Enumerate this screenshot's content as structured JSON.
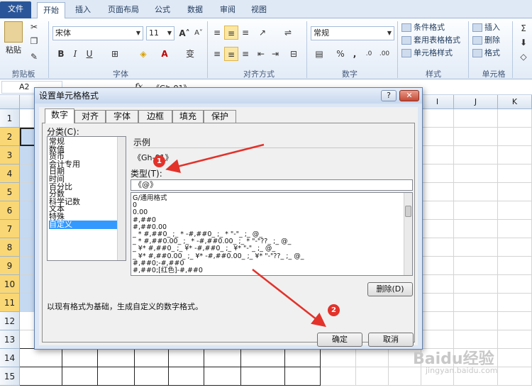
{
  "ribbon": {
    "tabs": [
      "文件",
      "开始",
      "插入",
      "页面布局",
      "公式",
      "数据",
      "审阅",
      "视图"
    ],
    "paste_label": "粘贴",
    "font_name": "宋体",
    "font_size": "11",
    "number_format": "常规",
    "styles": {
      "conditional": "条件格式",
      "table": "套用表格格式",
      "cell": "单元格样式"
    },
    "cells": {
      "insert": "插入",
      "delete": "删除",
      "format": "格式"
    },
    "groups": [
      "剪贴板",
      "字体",
      "对齐方式",
      "数字",
      "样式",
      "单元格"
    ],
    "icons": [
      "cut-icon",
      "copy-icon",
      "format-painter-icon",
      "bold-icon",
      "italic-icon",
      "underline-icon",
      "border-icon",
      "fill-color-icon",
      "font-color-icon",
      "align-icons",
      "percent-icon",
      "sum-icon"
    ]
  },
  "formula_bar": {
    "name_box": "A2",
    "fx": "fx",
    "content": "《Gh-01》"
  },
  "sheet": {
    "columns": [
      "I",
      "J",
      "K"
    ],
    "rows": [
      "1",
      "2",
      "3",
      "4",
      "5",
      "6",
      "7",
      "8",
      "9",
      "10",
      "11",
      "12",
      "13",
      "14",
      "15"
    ]
  },
  "dialog": {
    "title": "设置单元格格式",
    "help": "?",
    "close": "✕",
    "tabs": [
      "数字",
      "对齐",
      "字体",
      "边框",
      "填充",
      "保护"
    ],
    "category_label": "分类(C):",
    "categories": [
      "常规",
      "数值",
      "货币",
      "会计专用",
      "日期",
      "时间",
      "百分比",
      "分数",
      "科学记数",
      "文本",
      "特殊",
      "自定义"
    ],
    "selected_category": "自定义",
    "sample_label": "示例",
    "sample_value": "《Gh-01》",
    "type_label": "类型(T):",
    "type_value": "《@》",
    "formats": [
      "G/通用格式",
      "0",
      "0.00",
      "#,##0",
      "#,##0.00",
      "_ * #,##0_ ;_ * -#,##0_ ;_ * \"-\"_ ;_ @_",
      "_ * #,##0.00_ ;_ * -#,##0.00_ ;_ * \"-\"??_ ;_ @_",
      "_ ¥* #,##0_ ;_ ¥* -#,##0_ ;_ ¥* \"-\"_ ;_ @_",
      "_ ¥* #,##0.00_ ;_ ¥* -#,##0.00_ ;_ ¥* \"-\"??_ ;_ @_",
      "#,##0;-#,##0",
      "#,##0;[红色]-#,##0"
    ],
    "delete_button": "删除(D)",
    "description": "以现有格式为基础，生成自定义的数字格式。",
    "ok_button": "确定",
    "cancel_button": "取消"
  },
  "annotations": {
    "badge1": "1",
    "badge2": "2",
    "arrow_color": "#e2322a"
  },
  "watermark": {
    "brand": "Baidu经验",
    "url": "jingyan.baidu.com"
  }
}
